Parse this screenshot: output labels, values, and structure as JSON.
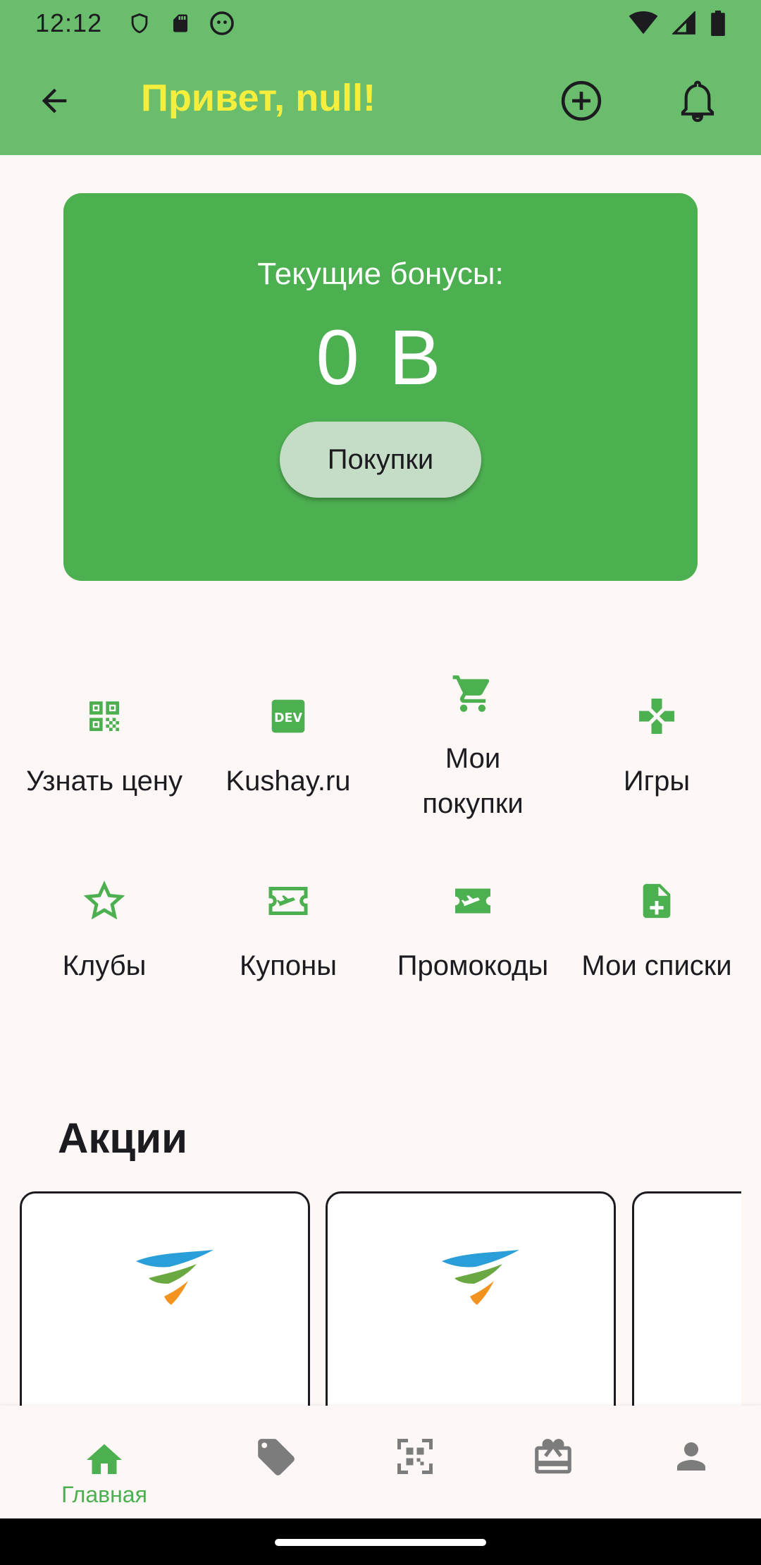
{
  "status_bar": {
    "time": "12:12"
  },
  "app_bar": {
    "title": "Привет, null!"
  },
  "bonus_card": {
    "label": "Текущие бонусы:",
    "value": "0 B",
    "button_label": "Покупки"
  },
  "actions": [
    {
      "label": "Узнать цену",
      "icon": "qr-code-icon"
    },
    {
      "label": "Kushay.ru",
      "icon": "dev-icon"
    },
    {
      "label": "Мои покупки",
      "icon": "cart-icon"
    },
    {
      "label": "Игры",
      "icon": "gamepad-icon"
    },
    {
      "label": "Клубы",
      "icon": "star-icon"
    },
    {
      "label": "Купоны",
      "icon": "ticket-outline-icon"
    },
    {
      "label": "Промокоды",
      "icon": "ticket-icon"
    },
    {
      "label": "Мои списки",
      "icon": "add-document-icon"
    }
  ],
  "promotions": {
    "title": "Акции"
  },
  "bottom_nav": {
    "items": [
      {
        "label": "Главная",
        "icon": "home-icon",
        "active": true
      },
      {
        "label": "",
        "icon": "tag-icon"
      },
      {
        "label": "",
        "icon": "qr-scan-icon"
      },
      {
        "label": "",
        "icon": "gift-card-icon"
      },
      {
        "label": "",
        "icon": "person-icon"
      }
    ]
  },
  "colors": {
    "app_bar": "#6abd6c",
    "title": "#f5ee3c",
    "accent": "#4caf50",
    "button": "#c5dcc7",
    "background": "#fdf7f6"
  }
}
